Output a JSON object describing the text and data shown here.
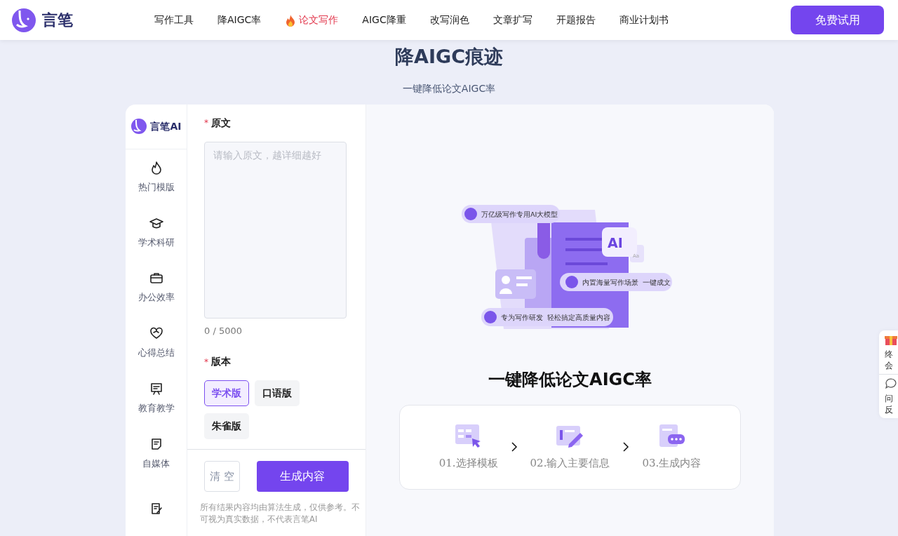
{
  "brand": {
    "name": "言笔"
  },
  "nav": [
    {
      "label": "写作工具",
      "selected": false
    },
    {
      "label": "降AIGC率",
      "selected": false
    },
    {
      "label": "论文写作",
      "selected": true
    },
    {
      "label": "AIGC降重",
      "selected": false
    },
    {
      "label": "改写润色",
      "selected": false
    },
    {
      "label": "文章扩写",
      "selected": false
    },
    {
      "label": "开题报告",
      "selected": false
    },
    {
      "label": "商业计划书",
      "selected": false
    }
  ],
  "trial_button": "免费试用",
  "heading": {
    "title": "降AIGC痕迹",
    "subtitle": "一键降低论文AIGC率"
  },
  "sidebar": {
    "brand": "言笔AI",
    "items": [
      {
        "kind": "flame",
        "label": "热门模版"
      },
      {
        "kind": "cap",
        "label": "学术科研"
      },
      {
        "kind": "briefcase",
        "label": "办公效率"
      },
      {
        "kind": "heart",
        "label": "心得总结"
      },
      {
        "kind": "board",
        "label": "教育教学"
      },
      {
        "kind": "note",
        "label": "自媒体"
      },
      {
        "kind": "pen"
      }
    ]
  },
  "form": {
    "required_mark": "*",
    "source_label": "原文",
    "source_placeholder": "请输入原文，越详细越好",
    "counter": "0 / 5000",
    "version_label": "版本",
    "versions": [
      {
        "label": "学术版",
        "selected": true
      },
      {
        "label": "口语版",
        "selected": false
      },
      {
        "label": "朱雀版",
        "selected": false
      }
    ],
    "clear_button": "清 空",
    "generate_button": "生成内容",
    "disclaimer": "所有结果内容均由算法生成，仅供参考。不可视为真实数据，不代表言笔AI"
  },
  "preview": {
    "illustration_tags": [
      "万亿级写作专用AI大模型",
      "内置海量写作场景  一键成文",
      "专为写作研发  轻松搞定高质量内容"
    ],
    "badge": "AI",
    "small_mark": "Aa",
    "title": "一键降低论文AIGC率",
    "steps": [
      {
        "kind": "grid",
        "label": "01.选择模板"
      },
      {
        "kind": "form",
        "label": "02.输入主要信息"
      },
      {
        "kind": "chat",
        "label": "03.生成内容"
      }
    ]
  },
  "float_panel": [
    {
      "kind": "gift",
      "lines": [
        "终",
        "会"
      ]
    },
    {
      "kind": "bubble",
      "lines": [
        "问",
        "反"
      ]
    }
  ]
}
